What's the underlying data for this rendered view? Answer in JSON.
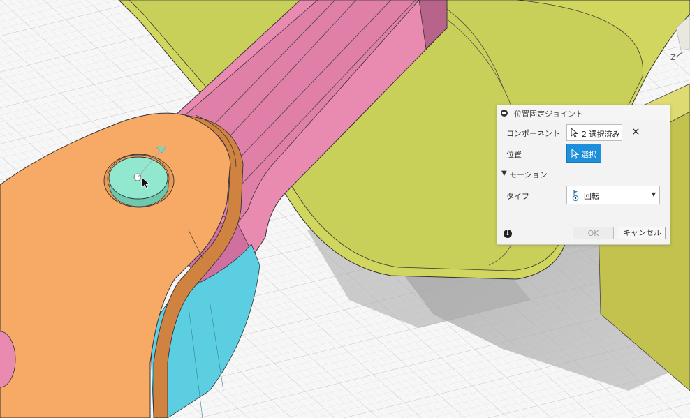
{
  "dialog": {
    "title": "位置固定ジョイント",
    "component_label": "コンポーネント",
    "component_value": "2 選択済み",
    "clear_icon": "close-icon",
    "position_label": "位置",
    "position_button": "選択",
    "motion_section": "モーション",
    "type_label": "タイプ",
    "type_value": "回転",
    "ok_label": "OK",
    "cancel_label": "キャンセル",
    "accent_color": "#1e8fdb"
  },
  "viewcube": {
    "axis_label": "Z"
  },
  "model_colors": {
    "orange_part": "#f7a965",
    "pink_part": "#e68aae",
    "yellow_part": "#ccd45a",
    "blue_part": "#58cfe0",
    "pin": "#8fe6cc"
  }
}
